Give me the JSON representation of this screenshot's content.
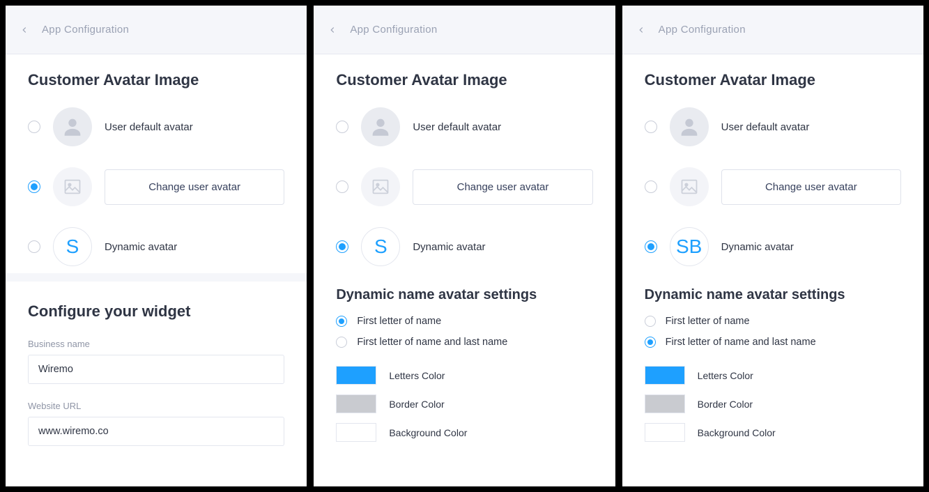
{
  "header": {
    "title": "App Configuration"
  },
  "section": {
    "avatar_heading": "Customer Avatar Image",
    "widget_heading": "Configure your widget",
    "dyn_heading": "Dynamic name avatar settings"
  },
  "options": {
    "default": "User default avatar",
    "change": "Change user avatar",
    "dynamic": "Dynamic avatar",
    "letter_single": "S",
    "letter_double": "SB"
  },
  "dyn": {
    "opt1": "First letter of name",
    "opt2": "First letter of name and last name",
    "letters_color_label": "Letters Color",
    "border_color_label": "Border Color",
    "bg_color_label": "Background Color",
    "letters_color": "#1ea0ff",
    "border_color": "#c9cbd0",
    "bg_color": "#ffffff"
  },
  "widget": {
    "business_label": "Business name",
    "business_value": "Wiremo",
    "url_label": "Website URL",
    "url_value": "www.wiremo.co"
  }
}
